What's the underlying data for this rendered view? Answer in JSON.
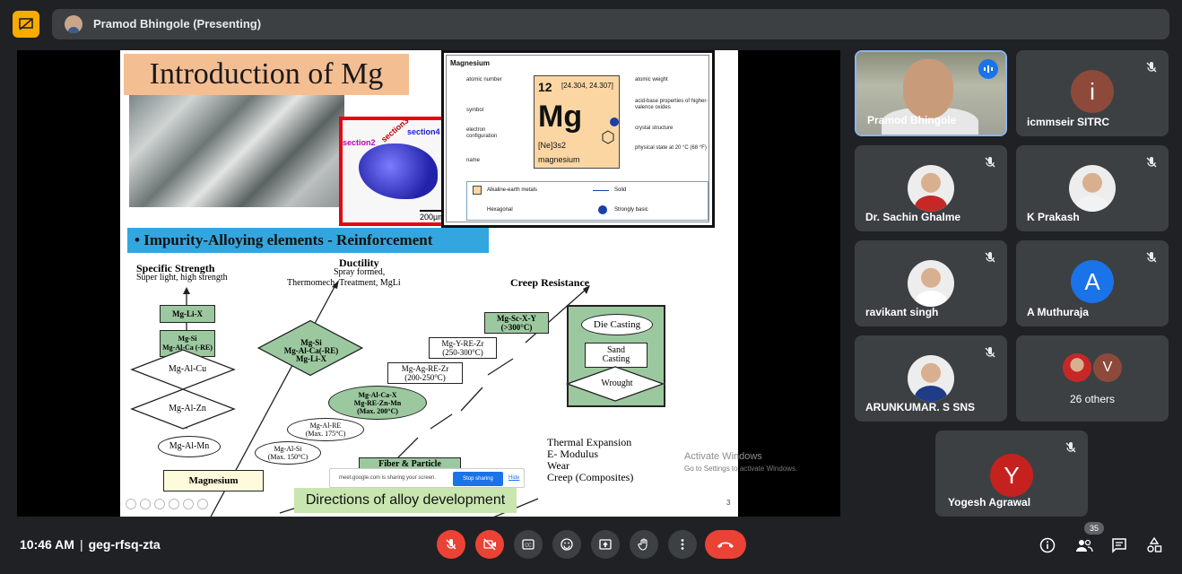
{
  "presenter_bar": {
    "name": "Pramod Bhingole (Presenting)",
    "icon": "presentation-icon"
  },
  "slide": {
    "title": "Introduction of Mg",
    "micro_labels": [
      "section2",
      "section3",
      "section4",
      "200µm"
    ],
    "periodic": {
      "header": "Magnesium",
      "atomic_number": "12",
      "atomic_weight": "[24.304, 24.307]",
      "symbol": "Mg",
      "configuration": "[Ne]3s2",
      "name": "magnesium",
      "left_labels": [
        "atomic number",
        "symbol",
        "electron configuration",
        "name"
      ],
      "right_labels": [
        "atomic weight",
        "acid-base properties of higher-valence oxides",
        "crystal structure",
        "physical state at 20 °C (68 °F)"
      ],
      "legend": [
        "Alkaline-earth metals",
        "Solid",
        "Hexagonal",
        "Strongly basic"
      ]
    },
    "banner": "•  Impurity-Alloying elements - Reinforcement",
    "diagram": {
      "specific_strength": "Specific Strength",
      "specific_strength_sub": "Super light, high strength",
      "ductility": "Ductility",
      "ductility_sub1": "Spray formed,",
      "ductility_sub2": "Thermomech. Treatment, MgLi",
      "creep": "Creep Resistance",
      "mg_li_x": "Mg-Li-X",
      "mg_si_alca": "Mg-Si\nMg-Al-Ca (-RE)",
      "mg_al_cu": "Mg-Al-Cu",
      "mg_al_zn": "Mg-Al-Zn",
      "mg_al_mn": "Mg-Al-Mn",
      "magnesium": "Magnesium",
      "green_diamond": "Mg-Si\nMg-Al-Ca(-RE)\nMg-Li-X",
      "mg_al_si": "Mg-Al-Si\n(Max. 150°C)",
      "mg_al_re": "Mg-Al-RE\n(Max. 175°C)",
      "green_ellipse": "Mg-Al-Ca-X\nMg-RE-Zn-Mn\n(Max. 200°C)",
      "mg_ag": "Mg-Ag-RE-Zr\n(200-250°C)",
      "mg_y": "Mg-Y-RE-Zr\n(250-300°C)",
      "mg_sc": "Mg-Sc-X-Y\n(>300°C)",
      "die_casting": "Die Casting",
      "sand_casting": "Sand\nCasting",
      "wrought": "Wrought",
      "fiber": "Fiber & Particle",
      "thermal": "Thermal Expansion",
      "emod": "E- Modulus",
      "wear": "Wear",
      "creep_comp": "Creep (Composites)"
    },
    "caption": "Directions of alloy development",
    "slide_number": "3",
    "share_text": "meet.google.com is sharing your screen.",
    "stop_sharing": "Stop sharing",
    "hide": "Hide",
    "activate_title": "Activate Windows",
    "activate_sub": "Go to Settings to activate Windows."
  },
  "participants": [
    {
      "name": "Pramod Bhingole",
      "type": "video",
      "speaking": true
    },
    {
      "name": "icmmseir SITRC",
      "initial": "i",
      "color": "#8d4a3a",
      "muted": true
    },
    {
      "name": "Dr. Sachin Ghalme",
      "type": "photo",
      "muted": true
    },
    {
      "name": "K Prakash",
      "type": "photo",
      "muted": true
    },
    {
      "name": "ravikant singh",
      "type": "photo",
      "muted": true
    },
    {
      "name": "A Muthuraja",
      "initial": "A",
      "color": "#1a73e8",
      "muted": true
    },
    {
      "name": "ARUNKUMAR. S SNS",
      "type": "photo",
      "muted": true
    },
    {
      "name": "26 others",
      "initial": "V",
      "color": "#8d4a3a"
    },
    {
      "name": "Yogesh Agrawal",
      "initial": "Y",
      "color": "#c5221f",
      "muted": true
    }
  ],
  "bottom": {
    "time": "10:46 AM",
    "separator": "|",
    "meeting_code": "geg-rfsq-zta",
    "participant_count": "35"
  },
  "colors": {
    "background": "#202124",
    "tile": "#3c4043",
    "danger": "#ea4335",
    "accent": "#1a73e8"
  }
}
